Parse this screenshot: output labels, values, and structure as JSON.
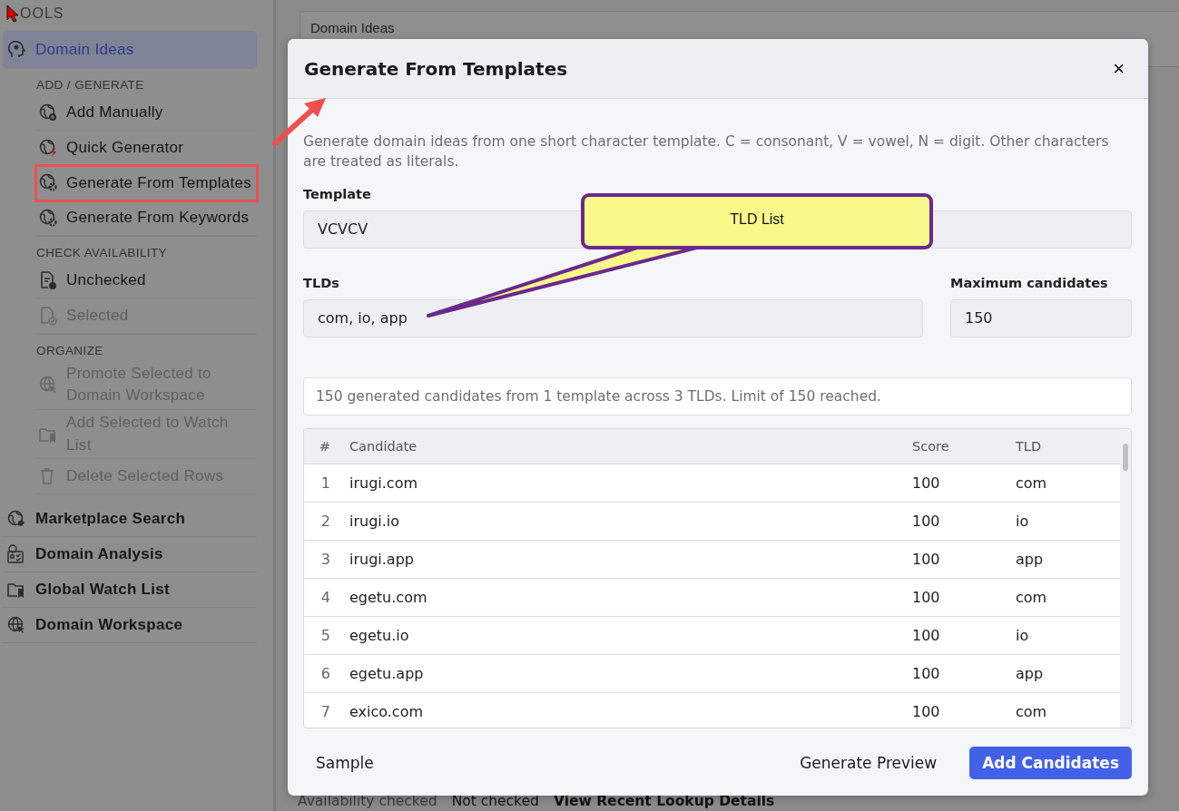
{
  "sidebar": {
    "title": "OOLS",
    "items": [
      {
        "label": "Domain Ideas",
        "selected": true,
        "groups": [
          {
            "heading": "ADD / GENERATE",
            "items": [
              {
                "label": "Add Manually",
                "disabled": false,
                "highlighted": false
              },
              {
                "label": "Quick Generator",
                "disabled": false,
                "highlighted": false
              },
              {
                "label": "Generate From Templates",
                "disabled": false,
                "highlighted": true
              },
              {
                "label": "Generate From Keywords",
                "disabled": false,
                "highlighted": false
              }
            ]
          },
          {
            "heading": "CHECK AVAILABILITY",
            "items": [
              {
                "label": "Unchecked",
                "disabled": false,
                "highlighted": false
              },
              {
                "label": "Selected",
                "disabled": true,
                "highlighted": false
              }
            ]
          },
          {
            "heading": "ORGANIZE",
            "items": [
              {
                "label": "Promote Selected to Domain Workspace",
                "disabled": true,
                "highlighted": false
              },
              {
                "label": "Add Selected to Watch List",
                "disabled": true,
                "highlighted": false
              },
              {
                "label": "Delete Selected Rows",
                "disabled": true,
                "highlighted": false
              }
            ]
          }
        ]
      },
      {
        "label": "Marketplace Search",
        "selected": false
      },
      {
        "label": "Domain Analysis",
        "selected": false
      },
      {
        "label": "Global Watch List",
        "selected": false
      },
      {
        "label": "Domain Workspace",
        "selected": false
      }
    ]
  },
  "background": {
    "panel_title": "Domain Ideas",
    "status": [
      {
        "kind": "label",
        "text": "Availability checked"
      },
      {
        "kind": "value",
        "text": "Not checked"
      },
      {
        "kind": "link",
        "text": "View Recent Lookup Details"
      }
    ]
  },
  "dialog": {
    "title": "Generate From Templates",
    "close": "×",
    "description": "Generate domain ideas from one short character template. C = consonant, V = vowel, N = digit. Other characters are treated as literals.",
    "template": {
      "label": "Template",
      "value": "VCVCV"
    },
    "tlds": {
      "label": "TLDs",
      "value": "com, io, app"
    },
    "max": {
      "label": "Maximum candidates",
      "value": "150"
    },
    "summary": "150 generated candidates from 1 template across 3 TLDs. Limit of 150 reached.",
    "table": {
      "columns": [
        "#",
        "Candidate",
        "Score",
        "TLD"
      ],
      "rows": [
        [
          "1",
          "irugi.com",
          "100",
          "com"
        ],
        [
          "2",
          "irugi.io",
          "100",
          "io"
        ],
        [
          "3",
          "irugi.app",
          "100",
          "app"
        ],
        [
          "4",
          "egetu.com",
          "100",
          "com"
        ],
        [
          "5",
          "egetu.io",
          "100",
          "io"
        ],
        [
          "6",
          "egetu.app",
          "100",
          "app"
        ],
        [
          "7",
          "exico.com",
          "100",
          "com"
        ]
      ]
    },
    "buttons": [
      {
        "label": "Sample",
        "kind": "plain"
      },
      {
        "label": "Generate Preview",
        "kind": "plain"
      },
      {
        "label": "Add Candidates",
        "kind": "primary"
      }
    ]
  },
  "callout": {
    "text": "TLD List"
  }
}
